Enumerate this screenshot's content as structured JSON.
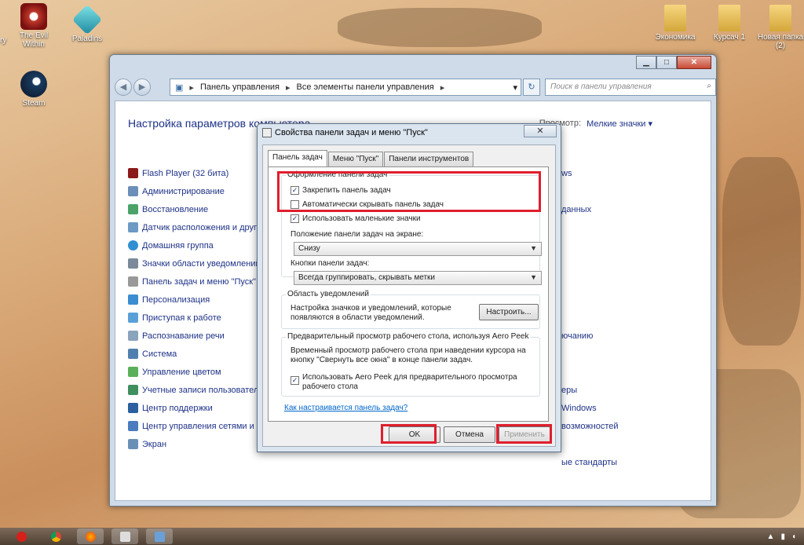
{
  "desktop": {
    "icons": [
      {
        "label": "The Evil Within",
        "name": "the-evil-within"
      },
      {
        "label": "Paladins",
        "name": "paladins"
      },
      {
        "label": "Steam",
        "name": "steam"
      },
      {
        "label": "Экономика",
        "name": "ekonomika-folder"
      },
      {
        "label": "Курсач 1",
        "name": "kursach-folder"
      },
      {
        "label": "Новая папка (2)",
        "name": "new-folder"
      }
    ],
    "edge_label": "ry"
  },
  "explorer": {
    "breadcrumb": [
      "Панель управления",
      "Все элементы панели управления"
    ],
    "search_placeholder": "Поиск в панели управления",
    "heading": "Настройка параметров компьютера",
    "view_label": "Просмотр:",
    "view_value": "Мелкие значки",
    "items": [
      "Flash Player (32 бита)",
      "Администрирование",
      "Восстановление",
      "Датчик расположения и друг",
      "Домашняя группа",
      "Значки области уведомлений",
      "Панель задач и меню \"Пуск\"",
      "Персонализация",
      "Приступая к работе",
      "Распознавание речи",
      "Система",
      "Управление цветом",
      "Учетные записи пользовател",
      "Центр поддержки",
      "Центр управления сетями и о",
      "Экран"
    ],
    "right_items": [
      "ws",
      "",
      "данных",
      "",
      "",
      "",
      "",
      "",
      "",
      "ючанию",
      "",
      "",
      "еры",
      "Windows",
      "возможностей",
      "",
      "ые стандарты"
    ]
  },
  "dialog": {
    "title": "Свойства панели задач и меню \"Пуск\"",
    "close": "✕",
    "tabs": [
      "Панель задач",
      "Меню \"Пуск\"",
      "Панели инструментов"
    ],
    "appearance": {
      "legend": "Оформление панели задач",
      "lock": {
        "label": "Закрепить панель задач",
        "checked": true
      },
      "autohide": {
        "label": "Автоматически скрывать панель задач",
        "checked": false
      },
      "small_icons": {
        "label": "Использовать маленькие значки",
        "checked": true
      },
      "position_label": "Положение панели задач на экране:",
      "position_value": "Снизу",
      "buttons_label": "Кнопки панели задач:",
      "buttons_value": "Всегда группировать, скрывать метки"
    },
    "notifications": {
      "legend": "Область уведомлений",
      "text": "Настройка значков и уведомлений, которые появляются в области уведомлений.",
      "button": "Настроить..."
    },
    "peek": {
      "legend": "Предварительный просмотр рабочего стола, используя Aero Peek",
      "text": "Временный просмотр рабочего стола при наведении курсора на кнопку \"Свернуть все окна\" в конце панели задач.",
      "checkbox": {
        "label": "Использовать Aero Peek для предварительного просмотра рабочего стола",
        "checked": true
      }
    },
    "link": "Как настраивается панель задач?",
    "ok": "OK",
    "cancel": "Отмена",
    "apply": "Применить"
  },
  "colors": {
    "highlight": "#e01e2d",
    "link": "#1e3287"
  }
}
